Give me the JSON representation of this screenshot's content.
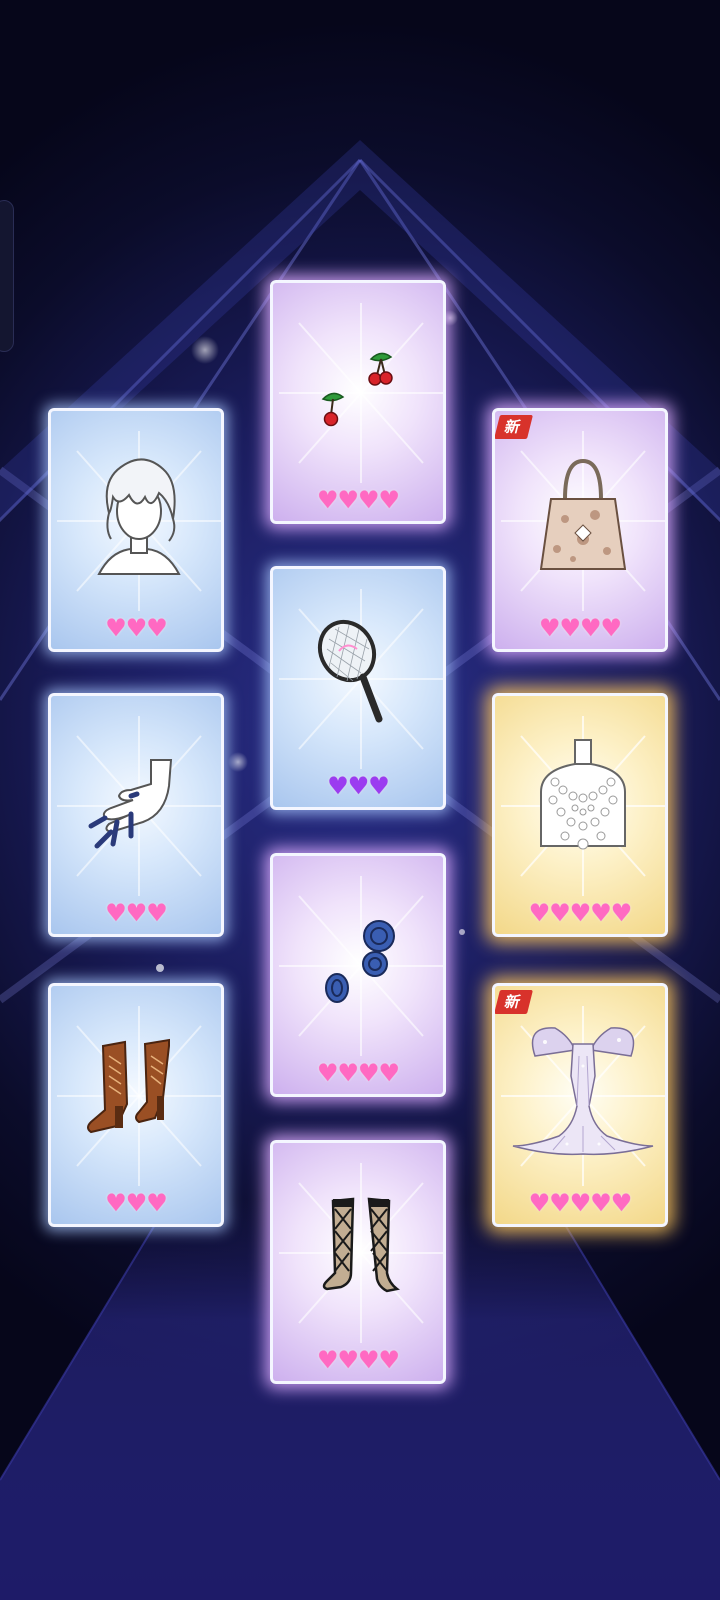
{
  "colors": {
    "heart_pink": "#ff69c2",
    "heart_violet": "#9b3cf0",
    "badge_red": "#d8322b",
    "card_blue": "#d6e7fb",
    "card_purple": "#f0e3fb",
    "card_gold": "#fdf1c8"
  },
  "cards": [
    {
      "item": "hair-icon",
      "rarity": "blue",
      "hearts": "♥♥♥",
      "heart_color": "pink",
      "badge": ""
    },
    {
      "item": "nails-icon",
      "rarity": "blue",
      "hearts": "♥♥♥",
      "heart_color": "pink",
      "badge": ""
    },
    {
      "item": "boots-icon",
      "rarity": "blue",
      "hearts": "♥♥♥",
      "heart_color": "pink",
      "badge": ""
    },
    {
      "item": "cherry-earrings-icon",
      "rarity": "purple",
      "hearts": "♥♥♥♥",
      "heart_color": "pink",
      "badge": ""
    },
    {
      "item": "tennis-racket-icon",
      "rarity": "blue",
      "hearts": "♥♥♥",
      "heart_color": "violet",
      "badge": ""
    },
    {
      "item": "buttons-icon",
      "rarity": "purple",
      "hearts": "♥♥♥♥",
      "heart_color": "pink",
      "badge": ""
    },
    {
      "item": "argyle-socks-icon",
      "rarity": "purple",
      "hearts": "♥♥♥♥",
      "heart_color": "pink",
      "badge": ""
    },
    {
      "item": "handbag-icon",
      "rarity": "purple",
      "hearts": "♥♥♥♥",
      "heart_color": "pink",
      "badge": "新"
    },
    {
      "item": "pearl-necklace-icon",
      "rarity": "gold",
      "hearts": "♥♥♥♥♥",
      "heart_color": "pink",
      "badge": ""
    },
    {
      "item": "gown-icon",
      "rarity": "gold",
      "hearts": "♥♥♥♥♥",
      "heart_color": "pink",
      "badge": "新"
    }
  ]
}
